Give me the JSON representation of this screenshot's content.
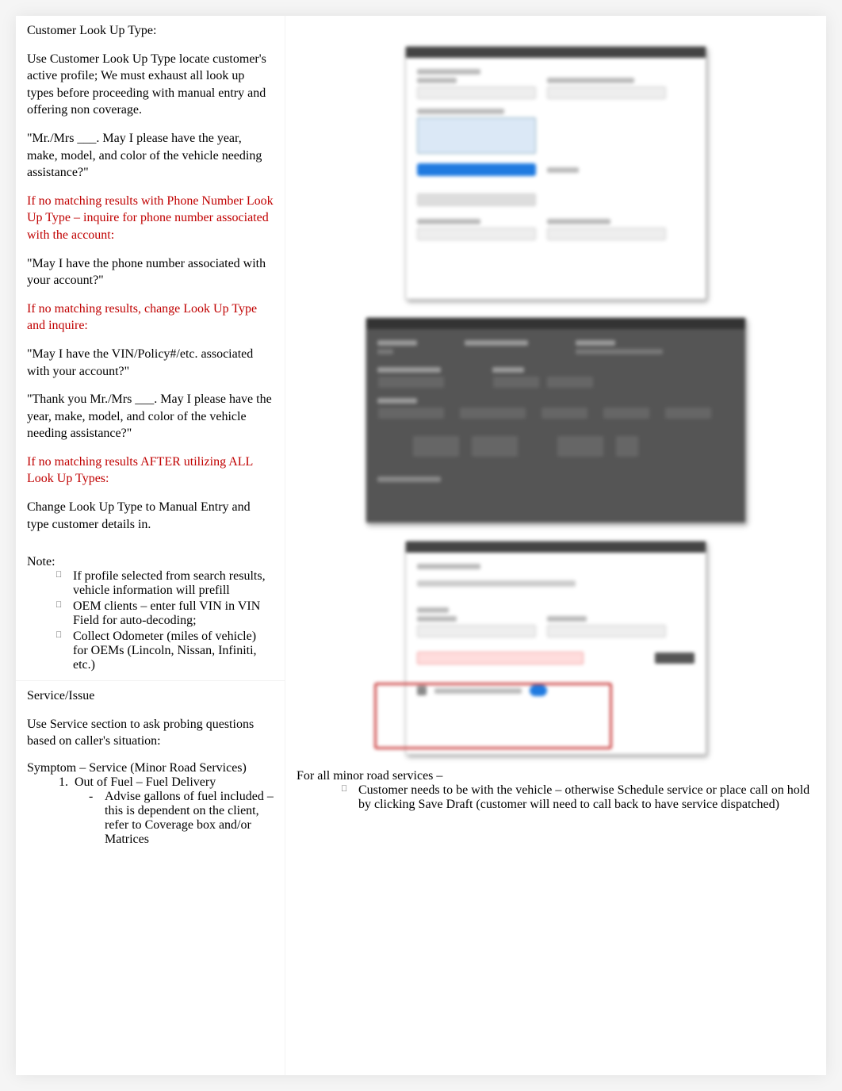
{
  "left": {
    "heading_lookup": "Customer Look Up Type:",
    "p_lookup_intro": "Use Customer Look Up Type locate customer's active profile; We must exhaust all look up types before proceeding with manual entry and offering non coverage.",
    "p_script_vehicle": "\"Mr./Mrs ___. May I please have the year, make, model, and color of the vehicle needing assistance?\"",
    "p_red_phone": " If no matching results with Phone Number Look Up Type – inquire for phone number associated with the account:",
    "p_script_phone": "\"May I have the phone number associated with your account?\"",
    "p_red_change": "If no matching results, change Look Up Type and inquire:",
    "p_script_vin": "\"May I have the VIN/Policy#/etc. associated with your account?\"",
    "p_script_thankyou": "\"Thank you Mr./Mrs ___. May I please have the year, make, model, and color of the vehicle needing assistance?\"",
    "p_red_all": "If no matching results AFTER utilizing ALL Look Up Types:",
    "p_manual_entry": "Change Look Up Type to Manual Entry and type customer details in.",
    "note_label": "Note:",
    "notes": [
      "If profile selected from search results, vehicle information will prefill",
      "OEM clients – enter full VIN in VIN Field for auto-decoding;",
      "Collect Odometer (miles of vehicle) for OEMs (Lincoln, Nissan, Infiniti, etc.)"
    ],
    "heading_service": "Service/Issue",
    "p_service_intro": "Use Service section to ask probing questions based on caller's situation:",
    "p_symptom_header": "Symptom – Service (Minor Road Services)",
    "symptom_item_1": "Out of Fuel – Fuel Delivery",
    "symptom_item_1_sub": "Advise gallons of fuel included – this is dependent on the client, refer to Coverage box and/or Matrices"
  },
  "right": {
    "p_minor_services": "For all minor road services  –",
    "minor_bullet_1": "Customer needs to be with the vehicle – otherwise Schedule service or place call on hold by clicking Save Draft (customer will need to call back to have service dispatched)"
  }
}
